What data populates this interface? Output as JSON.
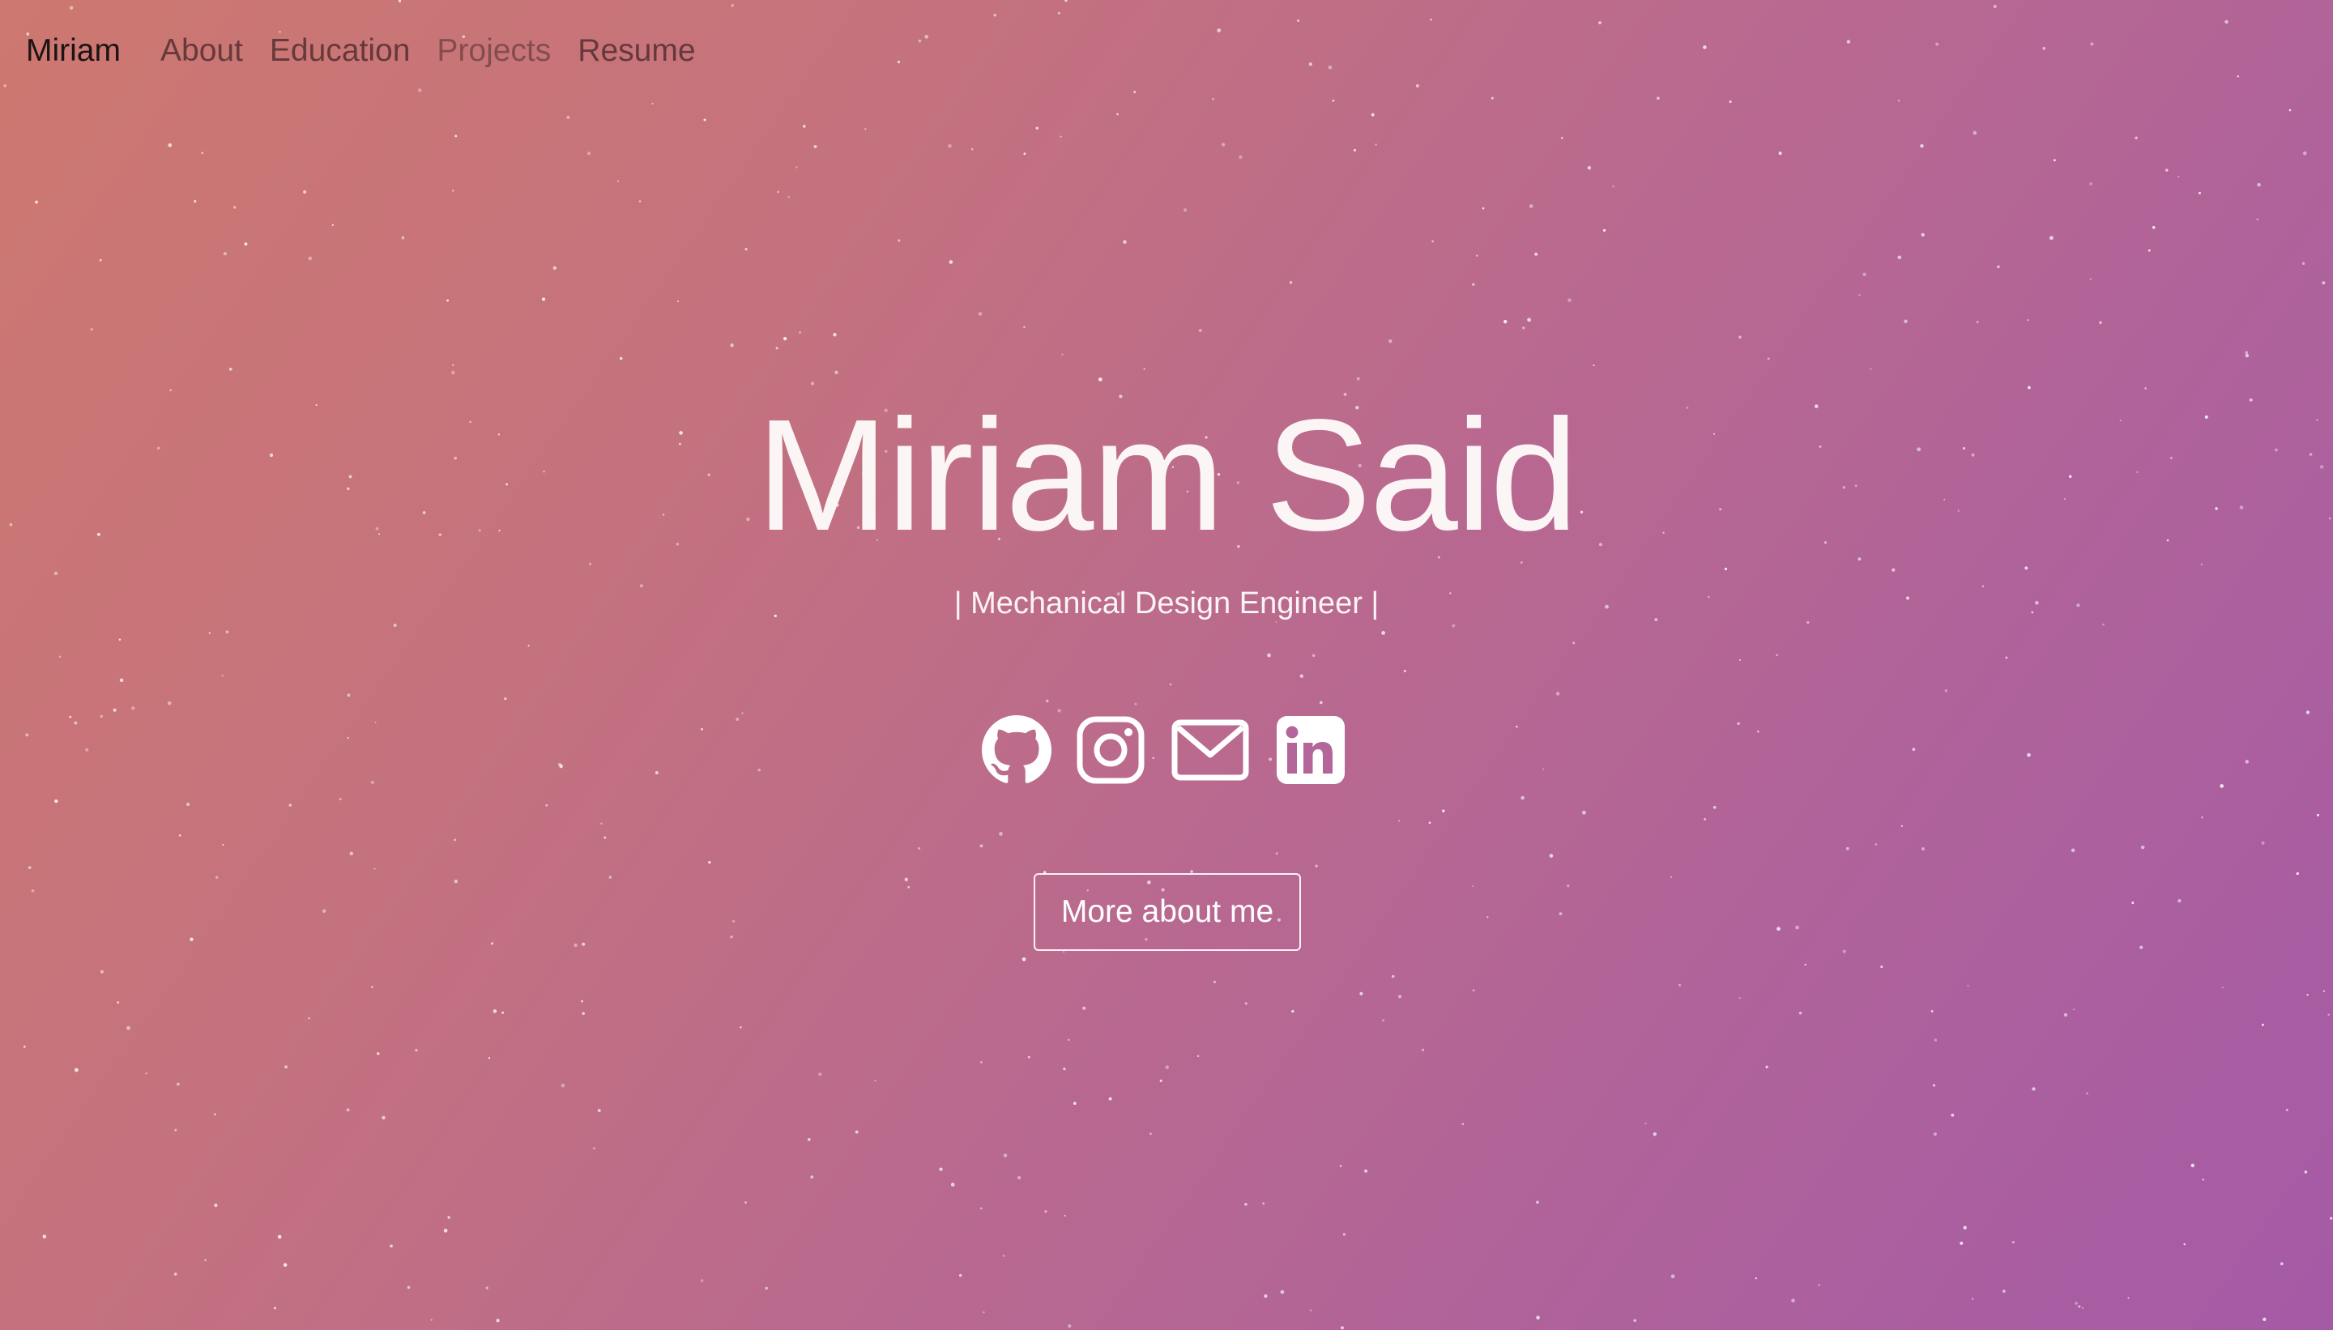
{
  "navbar": {
    "brand": "Miriam",
    "links": [
      {
        "label": "About"
      },
      {
        "label": "Education"
      },
      {
        "label": "Projects"
      },
      {
        "label": "Resume"
      }
    ]
  },
  "hero": {
    "title": "Miriam Said",
    "subtitle": "| Mechanical Design Engineer |",
    "social_icons": [
      "github-icon",
      "instagram-icon",
      "mail-icon",
      "linkedin-icon"
    ],
    "cta_label": "More about me"
  },
  "colors": {
    "gradient_start": "#cd7870",
    "gradient_end": "#a55aa6",
    "text_light": "#ffffff",
    "brand_text": "#1c1414"
  }
}
